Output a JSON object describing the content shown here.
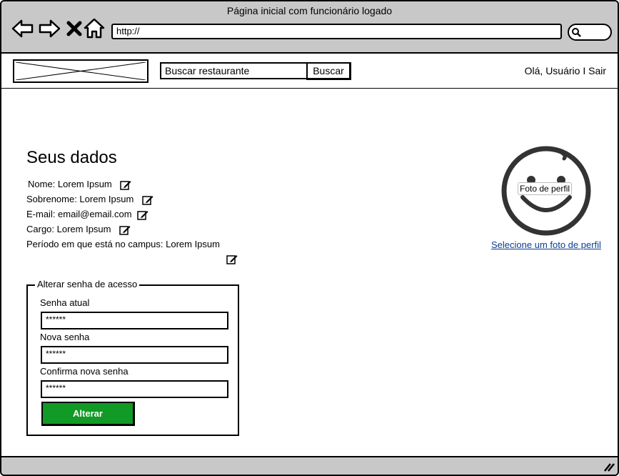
{
  "browser": {
    "window_title": "Página inicial com funcionário logado",
    "url": "http://"
  },
  "header": {
    "search_placeholder": "Buscar restaurante",
    "search_button": "Buscar",
    "greeting": "Olá, Usuário I Sair"
  },
  "profile": {
    "title": "Seus dados",
    "fields": [
      {
        "label": "Nome: Lorem Ipsum"
      },
      {
        "label": "Sobrenome: Lorem Ipsum"
      },
      {
        "label": "E-mail: email@email.com"
      },
      {
        "label": "Cargo: Lorem Ipsum"
      },
      {
        "label": "Período em que está no campus: Lorem Ipsum"
      }
    ],
    "photo_label": "Foto de perfil",
    "select_photo_link": "Selecione um foto de perfil"
  },
  "password": {
    "legend": "Alterar senha de acesso",
    "current_label": "Senha atual",
    "current_value": "******",
    "new_label": "Nova senha",
    "new_value": "******",
    "confirm_label": "Confirma nova senha",
    "confirm_value": "******",
    "submit": "Alterar"
  },
  "colors": {
    "chrome": "#c8c8c8",
    "button_green": "#119a25",
    "link": "#0a3d91"
  },
  "icons": [
    "back-icon",
    "forward-icon",
    "close-icon",
    "home-icon",
    "search-icon",
    "edit-icon",
    "smiley-avatar-icon",
    "resize-grip-icon"
  ]
}
